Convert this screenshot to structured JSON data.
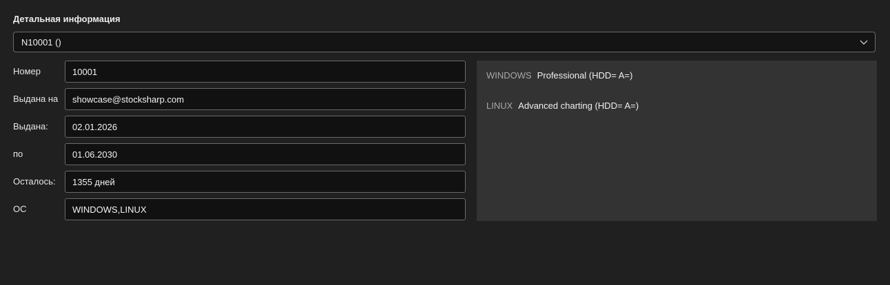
{
  "section": {
    "title": "Детальная информация"
  },
  "license_select": {
    "selected": "N10001 ()"
  },
  "details": {
    "rows": [
      {
        "label": "Номер",
        "value": "10001"
      },
      {
        "label": "Выдана на",
        "value": "showcase@stocksharp.com"
      },
      {
        "label": "Выдана:",
        "value": "02.01.2026"
      },
      {
        "label": "по",
        "value": "01.06.2030"
      },
      {
        "label": "Осталось:",
        "value": "1355 дней"
      },
      {
        "label": "ОС",
        "value": "WINDOWS,LINUX"
      }
    ]
  },
  "os_features": [
    {
      "os": "WINDOWS",
      "product": "Professional (HDD= A=)"
    },
    {
      "os": "LINUX",
      "product": "Advanced charting (HDD= A=)"
    }
  ],
  "icons": {
    "select_chevron": "chevron-down-icon"
  },
  "colors": {
    "background": "#202020",
    "field_background": "#111111",
    "field_border": "#6a6a6a",
    "panel_background": "#333333",
    "muted_text": "#a8a8a8"
  }
}
